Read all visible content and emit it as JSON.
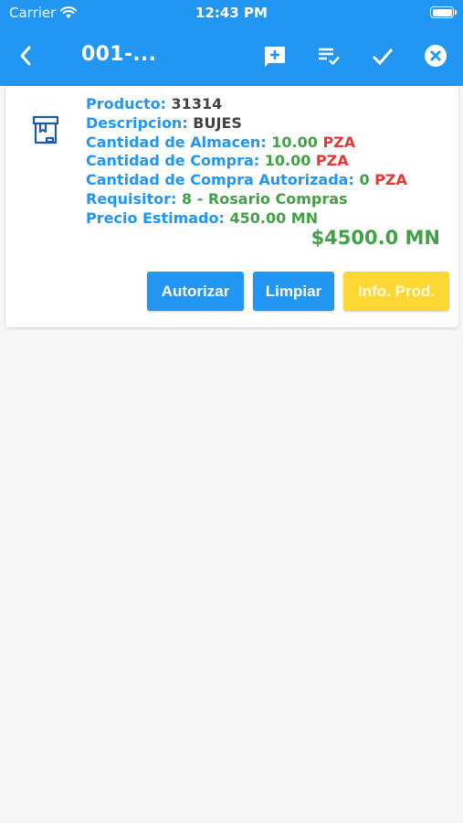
{
  "status_bar": {
    "carrier": "Carrier",
    "time": "12:43 PM"
  },
  "appbar": {
    "title": "001-...",
    "color": "#2196f3",
    "icons": [
      "back-icon",
      "add-comment-icon",
      "playlist-check-icon",
      "check-icon",
      "cancel-icon"
    ]
  },
  "item": {
    "producto_label": "Producto: ",
    "producto_value": "31314",
    "descripcion_label": "Descripcion: ",
    "descripcion_value": "BUJES",
    "almacen_label": "Cantidad de Almacen: ",
    "almacen_value": "10.00",
    "almacen_unit": "PZA",
    "compra_label": "Cantidad de Compra: ",
    "compra_value": "10.00",
    "compra_unit": "PZA",
    "autorizada_label": "Cantidad de Compra Autorizada: ",
    "autorizada_value": "0",
    "autorizada_unit": "PZA",
    "requisitor_label": "Requisitor: ",
    "requisitor_value": "8 - Rosario Compras",
    "precio_label": "Precio Estimado: ",
    "precio_value": "450.00 MN",
    "total": "$4500.0 MN",
    "icon": "inventory-box-icon"
  },
  "buttons": {
    "autorizar": "Autorizar",
    "limpiar": "Limpiar",
    "info": "Info. Prod."
  },
  "colors": {
    "label": "#2196f3",
    "value_green": "#43a047",
    "unit_red": "#e53935",
    "info_button": "#fdd835"
  }
}
